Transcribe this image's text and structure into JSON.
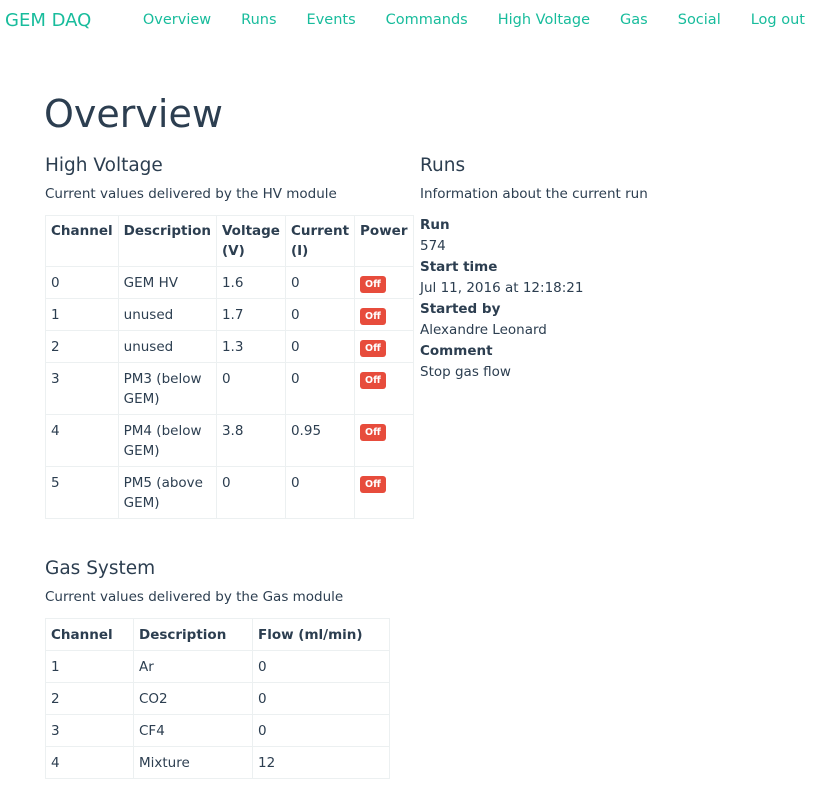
{
  "nav": {
    "brand": "GEM DAQ",
    "links": [
      "Overview",
      "Runs",
      "Events",
      "Commands",
      "High Voltage",
      "Gas",
      "Social",
      "Log out"
    ]
  },
  "page_title": "Overview",
  "hv": {
    "heading": "High Voltage",
    "lead": "Current values delivered by the HV module",
    "columns": [
      "Channel",
      "Description",
      "Voltage (V)",
      "Current (I)",
      "Power"
    ],
    "rows": [
      {
        "channel": "0",
        "description": "GEM HV",
        "voltage": "1.6",
        "current": "0",
        "power": "Off"
      },
      {
        "channel": "1",
        "description": "unused",
        "voltage": "1.7",
        "current": "0",
        "power": "Off"
      },
      {
        "channel": "2",
        "description": "unused",
        "voltage": "1.3",
        "current": "0",
        "power": "Off"
      },
      {
        "channel": "3",
        "description": "PM3 (below GEM)",
        "voltage": "0",
        "current": "0",
        "power": "Off"
      },
      {
        "channel": "4",
        "description": "PM4 (below GEM)",
        "voltage": "3.8",
        "current": "0.95",
        "power": "Off"
      },
      {
        "channel": "5",
        "description": "PM5 (above GEM)",
        "voltage": "0",
        "current": "0",
        "power": "Off"
      }
    ]
  },
  "gas": {
    "heading": "Gas System",
    "lead": "Current values delivered by the Gas module",
    "columns": [
      "Channel",
      "Description",
      "Flow (ml/min)"
    ],
    "rows": [
      {
        "channel": "1",
        "description": "Ar",
        "flow": "0"
      },
      {
        "channel": "2",
        "description": "CO2",
        "flow": "0"
      },
      {
        "channel": "3",
        "description": "CF4",
        "flow": "0"
      },
      {
        "channel": "4",
        "description": "Mixture",
        "flow": "12"
      }
    ]
  },
  "runs": {
    "heading": "Runs",
    "lead": "Information about the current run",
    "run_label": "Run",
    "run_value": "574",
    "start_label": "Start time",
    "start_value": "Jul 11, 2016 at 12:18:21",
    "started_by_label": "Started by",
    "started_by_value": "Alexandre Leonard",
    "comment_label": "Comment",
    "comment_value": "Stop gas flow"
  },
  "colors": {
    "accent": "#18bc9c",
    "text": "#2c3e50",
    "danger": "#e74c3c",
    "border": "#ecf0f1"
  }
}
